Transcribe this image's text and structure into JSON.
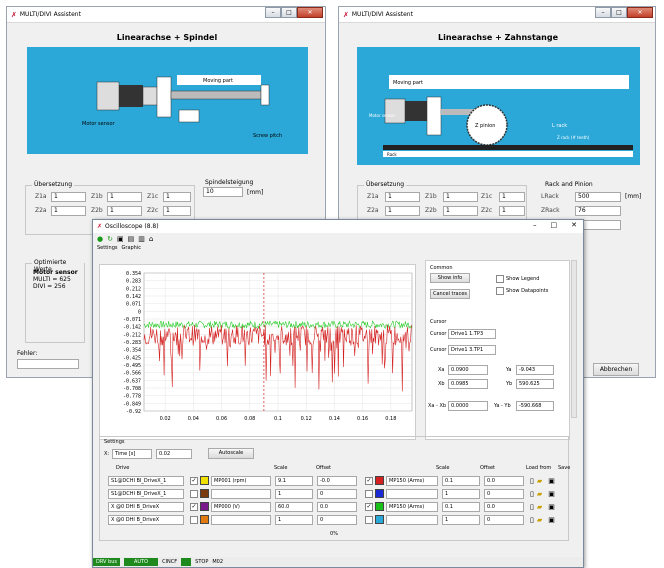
{
  "left": {
    "title": "MULTI/DIVI Assistent",
    "heading": "Linearachse + Spindel",
    "diagram": {
      "moving": "Moving part",
      "motor": "Motor sensor",
      "pitch": "Screw pitch"
    },
    "gear": {
      "title": "Übersetzung",
      "labels": [
        "Z1a",
        "Z1b",
        "Z1c",
        "Z2a",
        "Z2b",
        "Z2c"
      ],
      "values": [
        "1",
        "1",
        "1",
        "1",
        "1",
        "1"
      ]
    },
    "spindle": {
      "title": "Spindelsteigung",
      "value": "10",
      "unit": "[mm]"
    },
    "opt": {
      "title": "Optimierte Werte",
      "sensor": "Motor sensor",
      "multi": "MULTI = 625",
      "divi": "DIVI = 256"
    },
    "error": "Fehler:"
  },
  "right": {
    "title": "MULTI/DIVI Assistent",
    "heading": "Linearachse + Zahnstange",
    "diagram": {
      "moving": "Moving part",
      "pinion": "Z pinion",
      "rack": "Rack",
      "lrack": "L rack",
      "zrack": "Z rack (# teeth)",
      "motor": "Motor sensor"
    },
    "gear": {
      "title": "Übersetzung",
      "labels": [
        "Z1a",
        "Z1b",
        "Z1c",
        "Z2a",
        "Z2b",
        "Z2c"
      ],
      "values": [
        "1",
        "1",
        "1",
        "1",
        "1",
        "1"
      ]
    },
    "rp": {
      "title": "Rack and Pinion",
      "l_label": "LRack",
      "l_value": "500",
      "l_unit": "[mm]",
      "z_label": "ZRack",
      "z_value": "76",
      "zp_value": "0"
    },
    "cancel": "Abbrechen"
  },
  "osc": {
    "title": "Oscilloscope (8.8)",
    "tabs": [
      "Settings",
      "Graphic"
    ],
    "common": {
      "title": "Common",
      "showinfo": "Show info",
      "cancel": "Cancel traces",
      "legend": "Show Legend",
      "datapoints": "Show Datapoints"
    },
    "cursor": {
      "title": "Cursor",
      "c1": "Cursor 1",
      "c1v": "Drive1 1.TP3",
      "c2": "Cursor 2",
      "c2v": "Drive1 3.TP1",
      "xa": "Xa",
      "xa_v": "0.0900",
      "ya": "Ya",
      "ya_v": "-9.043",
      "xb": "Xb",
      "xb_v": "0.0985",
      "yb": "Yb",
      "yb_v": "590.625",
      "xd": "Xa - Xb",
      "xd_v": "0.0000",
      "yd": "Ya - Yb",
      "yd_v": "-590.668"
    },
    "settings": {
      "title": "Settings",
      "x": "X:",
      "time": "Time [s]",
      "tv": "0.02",
      "autoscale": "Autoscale",
      "h_drive": "Drive",
      "h_scale": "Scale",
      "h_offset": "Offset",
      "h_load": "Load from",
      "h_save": "Save",
      "rows": [
        {
          "drive": "S1@DCHI BI_DriveX_1",
          "ch": "MP001 (rpm)",
          "scale": "9.1",
          "off": "-0.0",
          "ch2": "MP150 (Arms)",
          "scale2": "0.1",
          "off2": "0.0"
        },
        {
          "drive": "S1@DCHI BI_DriveX_1",
          "ch": "",
          "scale": "1",
          "off": "0",
          "ch2": "",
          "scale2": "1",
          "off2": "0"
        },
        {
          "drive": "X @0 DHI B_DriveX",
          "ch": "MP000 (V)",
          "scale": "60.0",
          "off": "0.0",
          "ch2": "MP150 (Arms)",
          "scale2": "0.1",
          "off2": "0.0"
        },
        {
          "drive": "X @0 DHI B_DriveX",
          "ch": "",
          "scale": "1",
          "off": "0",
          "ch2": "",
          "scale2": "1",
          "off2": "0"
        }
      ],
      "progress": "0%"
    },
    "status": [
      "DRV bus",
      "AUTO",
      "CINCF",
      "STOP",
      "M02"
    ]
  },
  "chart_data": {
    "type": "line",
    "xlim": [
      0.005,
      0.195
    ],
    "ylim": [
      -0.92,
      0.39
    ],
    "xticks": [
      "0.02",
      "0.04",
      "0.06",
      "0.08",
      "0.1",
      "0.12",
      "0.14",
      "0.16",
      "0.18"
    ],
    "yticks": [
      "0.354",
      "0.283",
      "0.212",
      "0.142",
      "0.071",
      "0",
      "-0.071",
      "-0.142",
      "-0.212",
      "-0.283",
      "-0.354",
      "-0.425",
      "-0.495",
      "-0.566",
      "-0.637",
      "-0.708",
      "-0.778",
      "-0.849",
      "-0.92"
    ],
    "cursor_x": 0.09,
    "series": [
      {
        "color": "#2ecc2e",
        "mean": -0.1,
        "amp": 0.07
      },
      {
        "color": "#d42020",
        "mean": -0.2,
        "amp": 0.2
      }
    ]
  }
}
